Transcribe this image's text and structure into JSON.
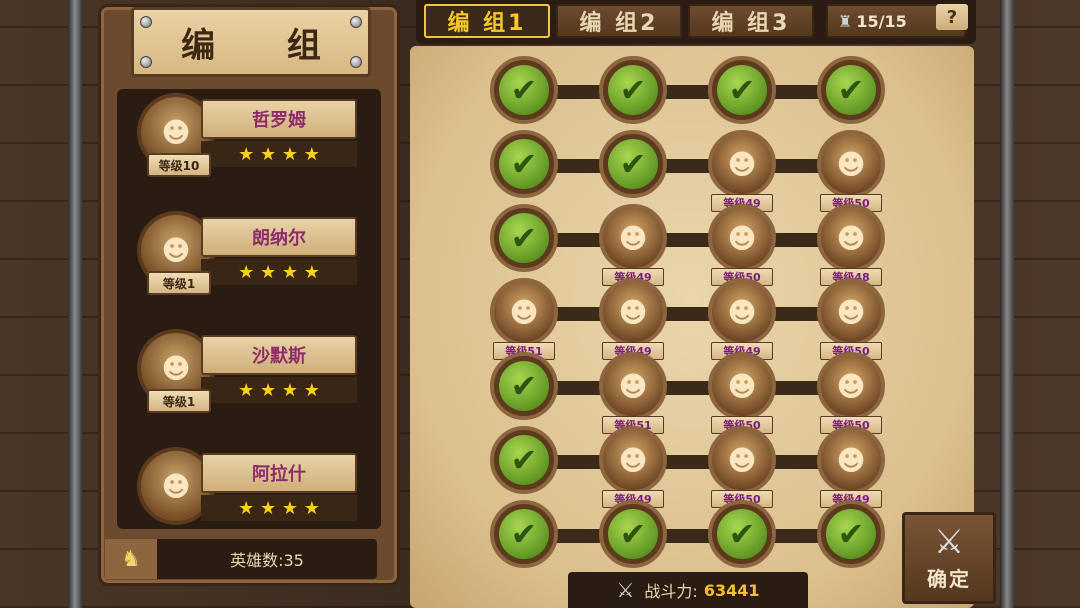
{
  "title": "编 组",
  "tabs": [
    {
      "label": "编 组1",
      "active": true
    },
    {
      "label": "编 组2",
      "active": false
    },
    {
      "label": "编 组3",
      "active": false
    }
  ],
  "capacity": "15/15",
  "help_label": "?",
  "heroes": [
    {
      "name": "哲罗姆",
      "level": "等级10",
      "stars": "★ ★ ★ ★"
    },
    {
      "name": "朗纳尔",
      "level": "等级1",
      "stars": "★ ★ ★ ★"
    },
    {
      "name": "沙默斯",
      "level": "等级1",
      "stars": "★ ★ ★ ★"
    },
    {
      "name": "阿拉什",
      "level": "",
      "stars": "★ ★ ★ ★"
    }
  ],
  "hero_count": "英雄数:35",
  "grid": [
    [
      {
        "empty": true
      },
      {
        "empty": true
      },
      {
        "empty": true
      },
      {
        "empty": true
      }
    ],
    [
      {
        "empty": true
      },
      {
        "empty": true
      },
      {
        "level": "等级49"
      },
      {
        "level": "等级50"
      }
    ],
    [
      {
        "empty": true
      },
      {
        "level": "等级49"
      },
      {
        "level": "等级50"
      },
      {
        "level": "等级48"
      }
    ],
    [
      {
        "level": "等级51"
      },
      {
        "level": "等级49"
      },
      {
        "level": "等级49"
      },
      {
        "level": "等级50"
      }
    ],
    [
      {
        "empty": true
      },
      {
        "level": "等级51"
      },
      {
        "level": "等级50"
      },
      {
        "level": "等级50"
      }
    ],
    [
      {
        "empty": true
      },
      {
        "level": "等级49"
      },
      {
        "level": "等级50"
      },
      {
        "level": "等级49"
      }
    ],
    [
      {
        "empty": true
      },
      {
        "empty": true
      },
      {
        "empty": true
      },
      {
        "empty": true
      }
    ]
  ],
  "power": {
    "label": "战斗力:",
    "value": "63441"
  },
  "confirm_label": "确定",
  "icons": {
    "check": "✔",
    "unit": "☻",
    "swords": "⚔",
    "capacity": "♜",
    "helmet": "♞"
  }
}
